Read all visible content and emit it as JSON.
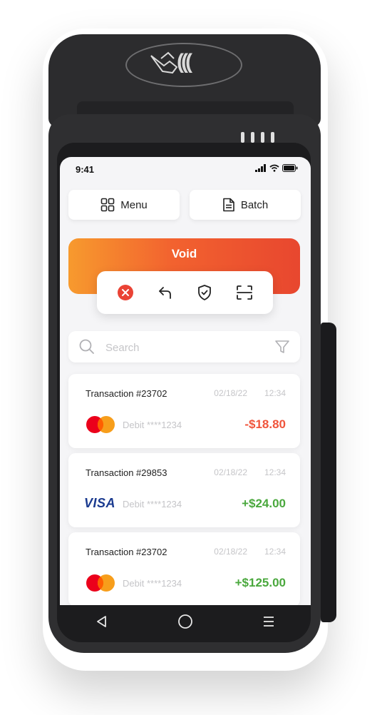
{
  "status_bar": {
    "time": "9:41"
  },
  "toolbar": {
    "menu_label": "Menu",
    "batch_label": "Batch"
  },
  "void_banner": {
    "title": "Void"
  },
  "search": {
    "placeholder": "Search"
  },
  "colors": {
    "accent_orange": "#f79a2e",
    "accent_red": "#e8472f",
    "amount_negative": "#f0543b",
    "amount_positive": "#4aa83d"
  },
  "transactions": [
    {
      "title": "Transaction #23702",
      "date": "02/18/22",
      "time": "12:34",
      "card_brand": "mastercard",
      "card_text": "Debit ****1234",
      "amount": "-$18.80"
    },
    {
      "title": "Transaction #29853",
      "date": "02/18/22",
      "time": "12:34",
      "card_brand": "VISA",
      "card_text": "Debit ****1234",
      "amount": "+$24.00"
    },
    {
      "title": "Transaction #23702",
      "date": "02/18/22",
      "time": "12:34",
      "card_brand": "mastercard",
      "card_text": "Debit ****1234",
      "amount": "+$125.00"
    }
  ],
  "icons": {
    "actions": [
      "cancel-icon",
      "undo-icon",
      "shield-check-icon",
      "scan-icon"
    ],
    "nav": [
      "back-icon",
      "home-icon",
      "recents-icon"
    ]
  }
}
